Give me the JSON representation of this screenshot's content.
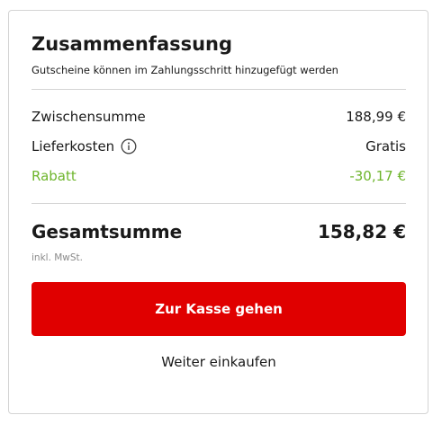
{
  "summary": {
    "title": "Zusammenfassung",
    "subtitle": "Gutscheine können im Zahlungsschritt hinzugefügt werden"
  },
  "rows": {
    "subtotal": {
      "label": "Zwischensumme",
      "value": "188,99 €"
    },
    "shipping": {
      "label": "Lieferkosten",
      "value": "Gratis",
      "icon": "info-icon"
    },
    "discount": {
      "label": "Rabatt",
      "value": "-30,17 €",
      "color": "#6eb52c"
    }
  },
  "total": {
    "label": "Gesamtsumme",
    "value": "158,82 €",
    "tax_note": "inkl. MwSt."
  },
  "actions": {
    "checkout_label": "Zur Kasse gehen",
    "checkout_color": "#e00000",
    "continue_label": "Weiter einkaufen"
  }
}
